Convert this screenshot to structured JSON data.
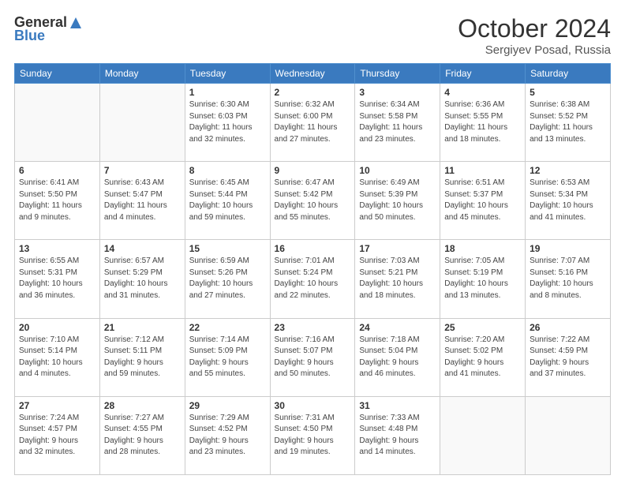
{
  "logo": {
    "line1": "General",
    "line2": "Blue"
  },
  "title": "October 2024",
  "subtitle": "Sergiyev Posad, Russia",
  "headers": [
    "Sunday",
    "Monday",
    "Tuesday",
    "Wednesday",
    "Thursday",
    "Friday",
    "Saturday"
  ],
  "weeks": [
    [
      {
        "day": "",
        "detail": ""
      },
      {
        "day": "",
        "detail": ""
      },
      {
        "day": "1",
        "detail": "Sunrise: 6:30 AM\nSunset: 6:03 PM\nDaylight: 11 hours\nand 32 minutes."
      },
      {
        "day": "2",
        "detail": "Sunrise: 6:32 AM\nSunset: 6:00 PM\nDaylight: 11 hours\nand 27 minutes."
      },
      {
        "day": "3",
        "detail": "Sunrise: 6:34 AM\nSunset: 5:58 PM\nDaylight: 11 hours\nand 23 minutes."
      },
      {
        "day": "4",
        "detail": "Sunrise: 6:36 AM\nSunset: 5:55 PM\nDaylight: 11 hours\nand 18 minutes."
      },
      {
        "day": "5",
        "detail": "Sunrise: 6:38 AM\nSunset: 5:52 PM\nDaylight: 11 hours\nand 13 minutes."
      }
    ],
    [
      {
        "day": "6",
        "detail": "Sunrise: 6:41 AM\nSunset: 5:50 PM\nDaylight: 11 hours\nand 9 minutes."
      },
      {
        "day": "7",
        "detail": "Sunrise: 6:43 AM\nSunset: 5:47 PM\nDaylight: 11 hours\nand 4 minutes."
      },
      {
        "day": "8",
        "detail": "Sunrise: 6:45 AM\nSunset: 5:44 PM\nDaylight: 10 hours\nand 59 minutes."
      },
      {
        "day": "9",
        "detail": "Sunrise: 6:47 AM\nSunset: 5:42 PM\nDaylight: 10 hours\nand 55 minutes."
      },
      {
        "day": "10",
        "detail": "Sunrise: 6:49 AM\nSunset: 5:39 PM\nDaylight: 10 hours\nand 50 minutes."
      },
      {
        "day": "11",
        "detail": "Sunrise: 6:51 AM\nSunset: 5:37 PM\nDaylight: 10 hours\nand 45 minutes."
      },
      {
        "day": "12",
        "detail": "Sunrise: 6:53 AM\nSunset: 5:34 PM\nDaylight: 10 hours\nand 41 minutes."
      }
    ],
    [
      {
        "day": "13",
        "detail": "Sunrise: 6:55 AM\nSunset: 5:31 PM\nDaylight: 10 hours\nand 36 minutes."
      },
      {
        "day": "14",
        "detail": "Sunrise: 6:57 AM\nSunset: 5:29 PM\nDaylight: 10 hours\nand 31 minutes."
      },
      {
        "day": "15",
        "detail": "Sunrise: 6:59 AM\nSunset: 5:26 PM\nDaylight: 10 hours\nand 27 minutes."
      },
      {
        "day": "16",
        "detail": "Sunrise: 7:01 AM\nSunset: 5:24 PM\nDaylight: 10 hours\nand 22 minutes."
      },
      {
        "day": "17",
        "detail": "Sunrise: 7:03 AM\nSunset: 5:21 PM\nDaylight: 10 hours\nand 18 minutes."
      },
      {
        "day": "18",
        "detail": "Sunrise: 7:05 AM\nSunset: 5:19 PM\nDaylight: 10 hours\nand 13 minutes."
      },
      {
        "day": "19",
        "detail": "Sunrise: 7:07 AM\nSunset: 5:16 PM\nDaylight: 10 hours\nand 8 minutes."
      }
    ],
    [
      {
        "day": "20",
        "detail": "Sunrise: 7:10 AM\nSunset: 5:14 PM\nDaylight: 10 hours\nand 4 minutes."
      },
      {
        "day": "21",
        "detail": "Sunrise: 7:12 AM\nSunset: 5:11 PM\nDaylight: 9 hours\nand 59 minutes."
      },
      {
        "day": "22",
        "detail": "Sunrise: 7:14 AM\nSunset: 5:09 PM\nDaylight: 9 hours\nand 55 minutes."
      },
      {
        "day": "23",
        "detail": "Sunrise: 7:16 AM\nSunset: 5:07 PM\nDaylight: 9 hours\nand 50 minutes."
      },
      {
        "day": "24",
        "detail": "Sunrise: 7:18 AM\nSunset: 5:04 PM\nDaylight: 9 hours\nand 46 minutes."
      },
      {
        "day": "25",
        "detail": "Sunrise: 7:20 AM\nSunset: 5:02 PM\nDaylight: 9 hours\nand 41 minutes."
      },
      {
        "day": "26",
        "detail": "Sunrise: 7:22 AM\nSunset: 4:59 PM\nDaylight: 9 hours\nand 37 minutes."
      }
    ],
    [
      {
        "day": "27",
        "detail": "Sunrise: 7:24 AM\nSunset: 4:57 PM\nDaylight: 9 hours\nand 32 minutes."
      },
      {
        "day": "28",
        "detail": "Sunrise: 7:27 AM\nSunset: 4:55 PM\nDaylight: 9 hours\nand 28 minutes."
      },
      {
        "day": "29",
        "detail": "Sunrise: 7:29 AM\nSunset: 4:52 PM\nDaylight: 9 hours\nand 23 minutes."
      },
      {
        "day": "30",
        "detail": "Sunrise: 7:31 AM\nSunset: 4:50 PM\nDaylight: 9 hours\nand 19 minutes."
      },
      {
        "day": "31",
        "detail": "Sunrise: 7:33 AM\nSunset: 4:48 PM\nDaylight: 9 hours\nand 14 minutes."
      },
      {
        "day": "",
        "detail": ""
      },
      {
        "day": "",
        "detail": ""
      }
    ]
  ]
}
